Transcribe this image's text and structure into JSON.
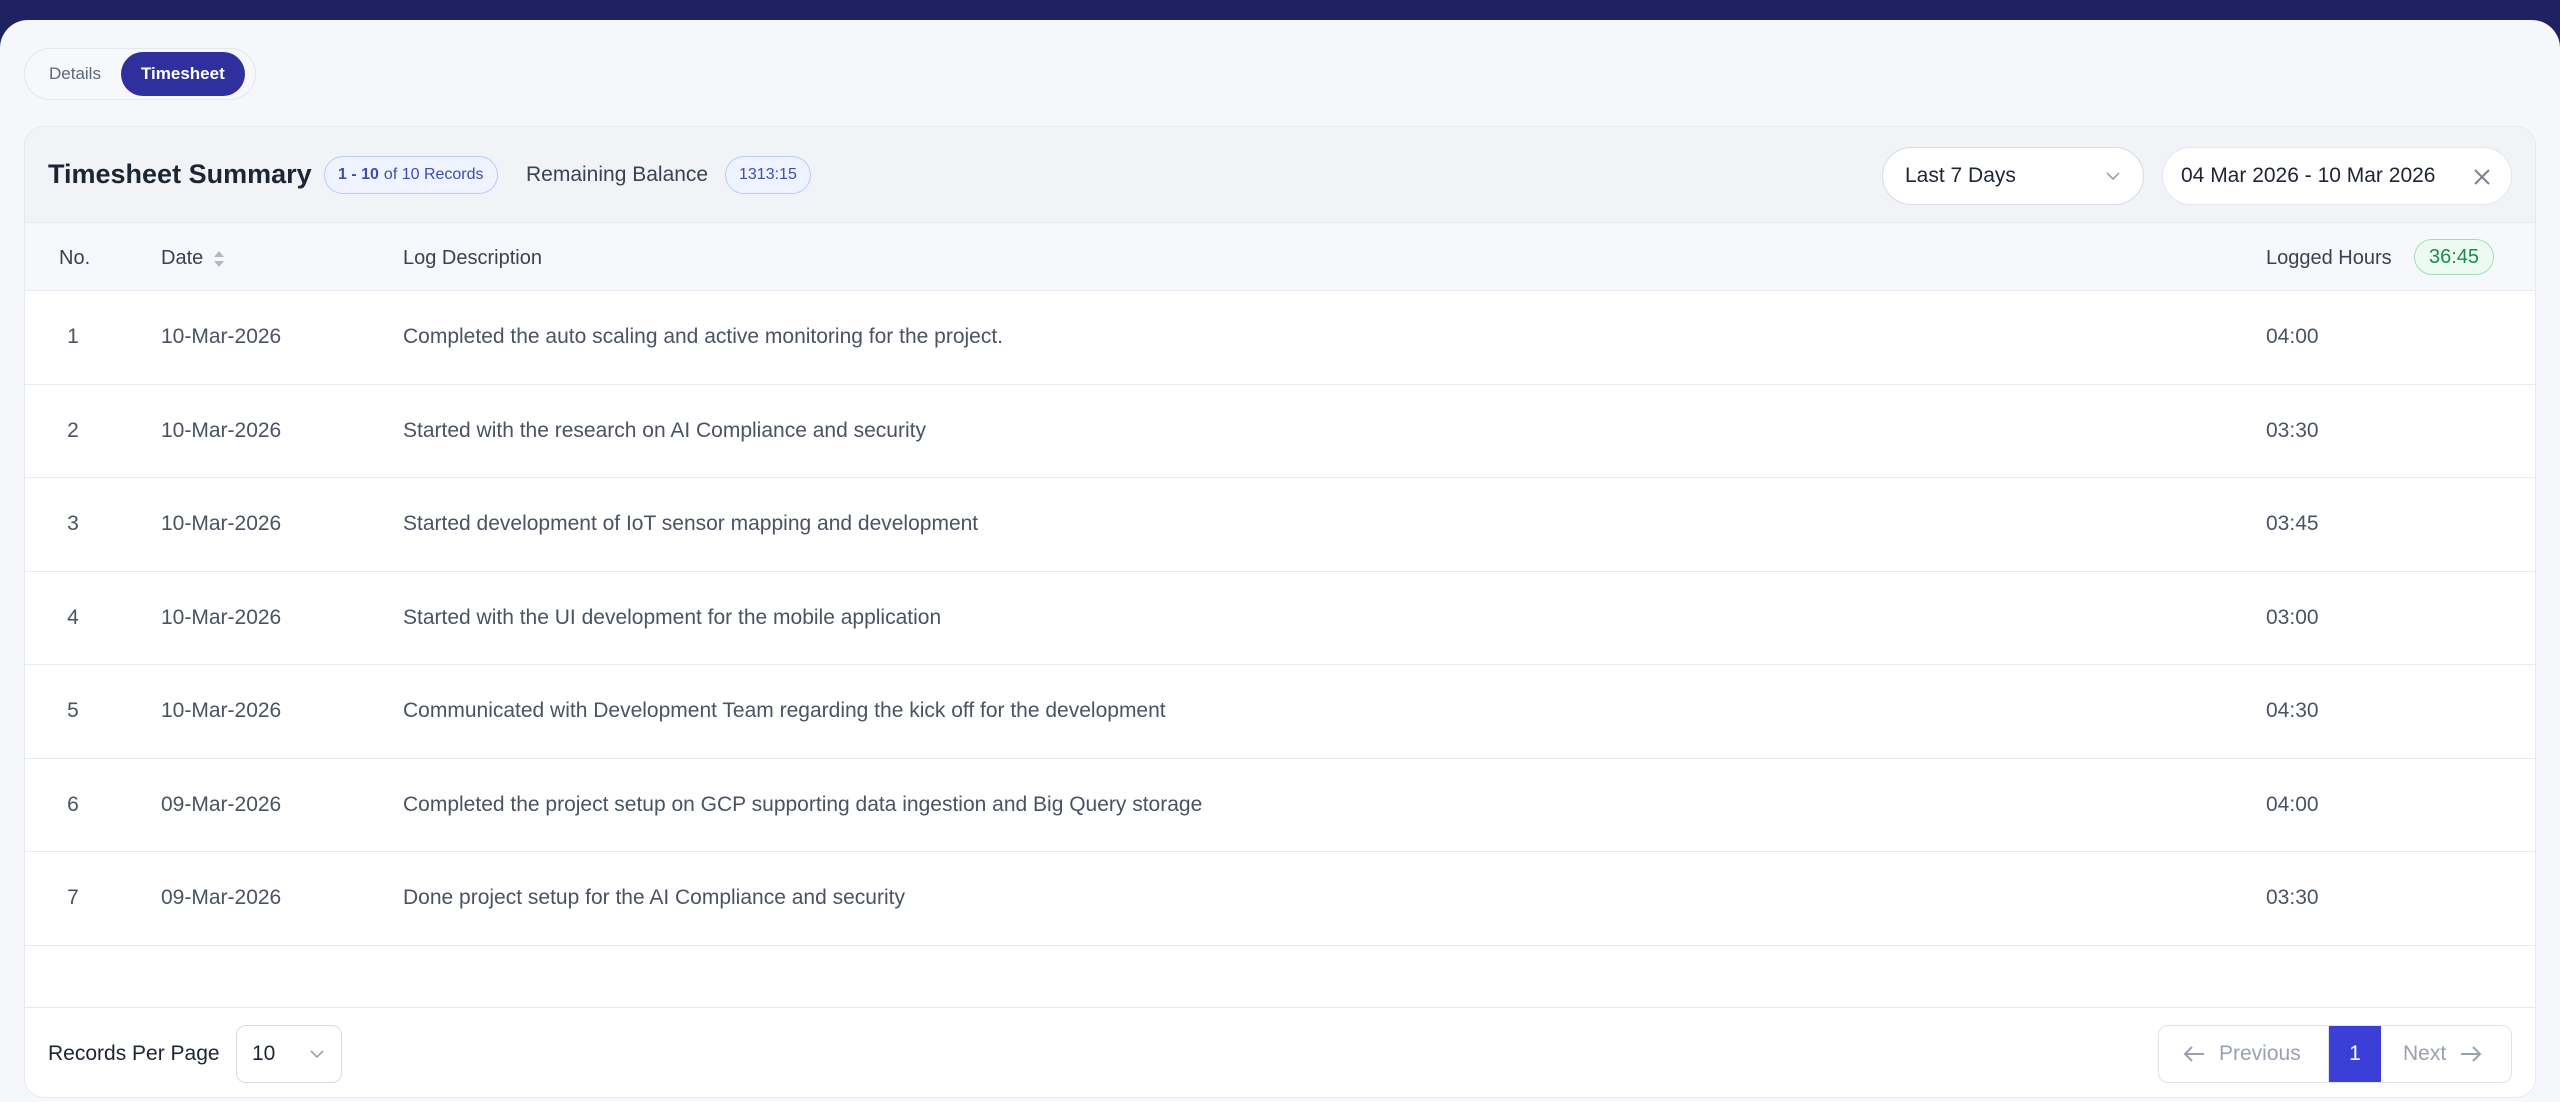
{
  "tabs": [
    {
      "label": "Details",
      "active": false
    },
    {
      "label": "Timesheet",
      "active": true
    }
  ],
  "summary": {
    "title": "Timesheet Summary",
    "records_range": "1 - 10",
    "records_suffix": "of 10 Records",
    "remaining_label": "Remaining Balance",
    "remaining_value": "1313:15"
  },
  "filters": {
    "range_select": "Last 7 Days",
    "date_range": "04 Mar 2026 - 10 Mar 2026"
  },
  "table": {
    "headers": {
      "no": "No.",
      "date": "Date",
      "desc": "Log Description",
      "hours": "Logged Hours"
    },
    "total_hours": "36:45",
    "rows": [
      {
        "no": "1",
        "date": "10-Mar-2026",
        "desc": "Completed the auto scaling and active monitoring for the project.",
        "hours": "04:00"
      },
      {
        "no": "2",
        "date": "10-Mar-2026",
        "desc": "Started with the research on AI Compliance and security",
        "hours": "03:30"
      },
      {
        "no": "3",
        "date": "10-Mar-2026",
        "desc": "Started development of IoT sensor mapping and development",
        "hours": "03:45"
      },
      {
        "no": "4",
        "date": "10-Mar-2026",
        "desc": "Started with the UI development for the mobile application",
        "hours": "03:00"
      },
      {
        "no": "5",
        "date": "10-Mar-2026",
        "desc": "Communicated with Development Team regarding the kick off for the development",
        "hours": "04:30"
      },
      {
        "no": "6",
        "date": "09-Mar-2026",
        "desc": "Completed the project setup on GCP supporting data ingestion and Big Query storage",
        "hours": "04:00"
      },
      {
        "no": "7",
        "date": "09-Mar-2026",
        "desc": "Done project setup for the AI Compliance and security",
        "hours": "03:30"
      }
    ]
  },
  "footer": {
    "rpp_label": "Records Per Page",
    "rpp_value": "10",
    "prev_label": "Previous",
    "current_page": "1",
    "next_label": "Next"
  }
}
